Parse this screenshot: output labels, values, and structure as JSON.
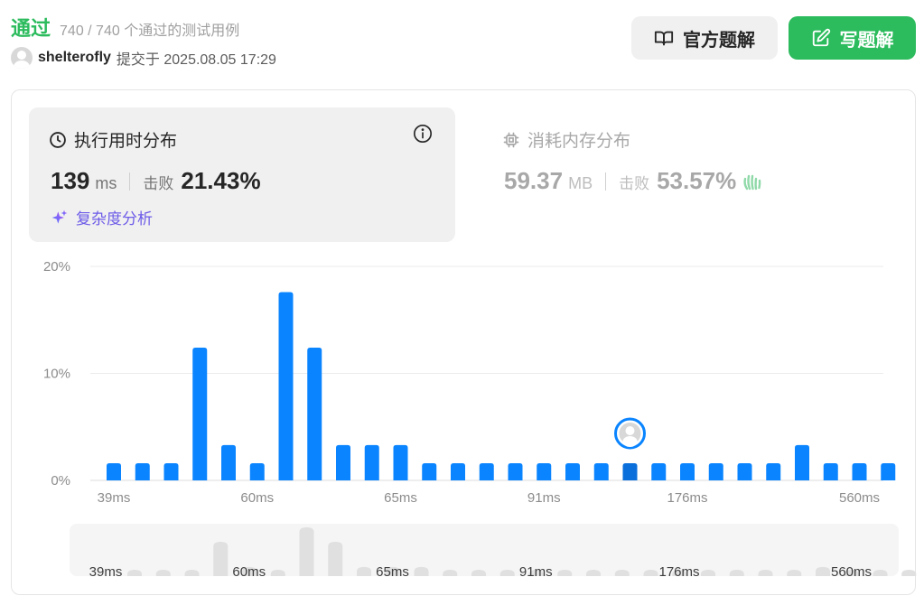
{
  "header": {
    "status": "通过",
    "test_count": "740 / 740 个通过的测试用例",
    "username": "shelterofly",
    "submit_info": "提交于 2025.08.05 17:29",
    "official_solution_label": "官方题解",
    "write_solution_label": "写题解"
  },
  "runtime": {
    "title": "执行用时分布",
    "value": "139",
    "unit": "ms",
    "beat_label": "击败",
    "beat": "21.43%",
    "complexity_label": "复杂度分析"
  },
  "memory": {
    "title": "消耗内存分布",
    "value": "59.37",
    "unit": "MB",
    "beat_label": "击败",
    "beat": "53.57%"
  },
  "colors": {
    "accent_green": "#2cbb5d",
    "bar_blue": "#0a84ff",
    "bar_selected": "#0a6fdb",
    "mini_bar": "#e0e0e0",
    "complexity_purple": "#6d5ce8"
  },
  "chart_data": {
    "type": "bar",
    "ylabel_ticks": [
      "0%",
      "10%",
      "20%"
    ],
    "ylim": [
      0,
      20
    ],
    "x_tick_labels": [
      "39ms",
      "60ms",
      "65ms",
      "91ms",
      "176ms",
      "560ms"
    ],
    "x_tick_positions": [
      0,
      5,
      10,
      15,
      20,
      26
    ],
    "values": [
      1.6,
      1.6,
      1.6,
      12.4,
      3.3,
      1.6,
      17.6,
      12.4,
      3.3,
      3.3,
      3.3,
      1.6,
      1.6,
      1.6,
      1.6,
      1.6,
      1.6,
      1.6,
      1.6,
      1.6,
      1.6,
      1.6,
      1.6,
      1.6,
      3.3,
      1.6,
      1.6,
      1.6
    ],
    "selected_index": 18,
    "grid": true
  }
}
